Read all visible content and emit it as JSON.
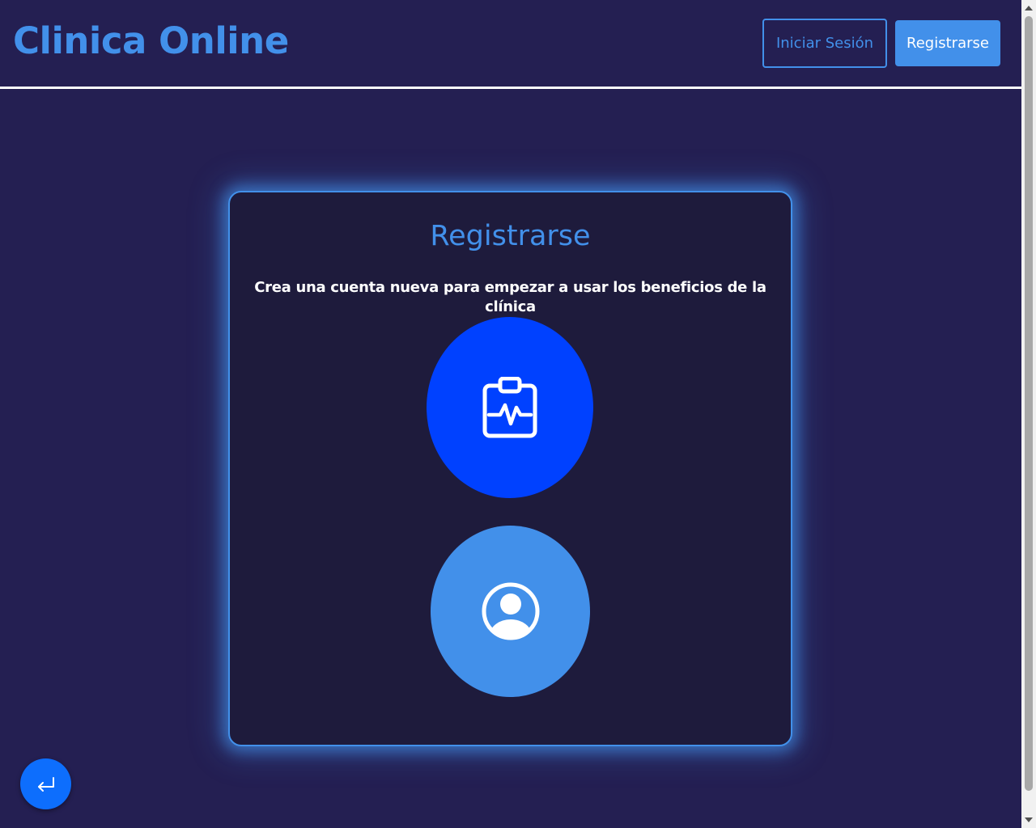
{
  "header": {
    "brand": "Clinica Online",
    "login_label": "Iniciar Sesión",
    "register_label": "Registrarse"
  },
  "card": {
    "title": "Registrarse",
    "subtitle": "Crea una cuenta nueva para empezar a usar los beneficios de la clínica",
    "options": [
      {
        "icon": "clipboard-pulse-icon",
        "color": "#0041ff"
      },
      {
        "icon": "person-circle-icon",
        "color": "#4290ea"
      }
    ]
  },
  "back_button": {
    "icon": "return-arrow-icon",
    "color": "#0d6efd"
  },
  "colors": {
    "background": "#241f52",
    "card_background": "#1e1b3c",
    "accent": "#4290ea"
  }
}
